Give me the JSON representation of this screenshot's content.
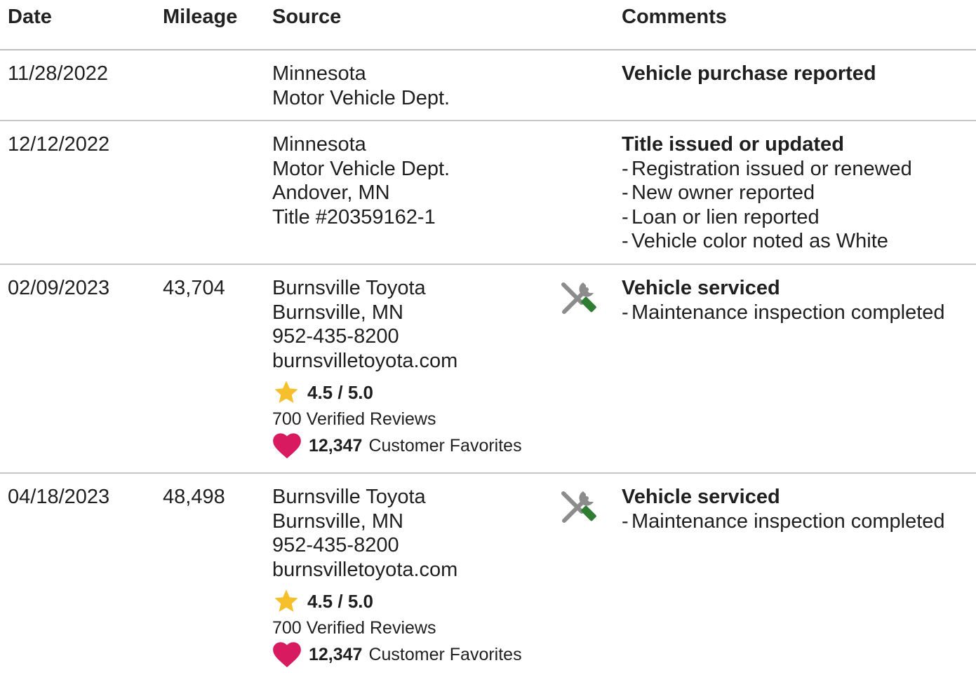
{
  "headers": {
    "date": "Date",
    "mileage": "Mileage",
    "source": "Source",
    "comments": "Comments"
  },
  "rows": [
    {
      "date": "11/28/2022",
      "mileage": "",
      "source": [
        "Minnesota",
        "Motor Vehicle Dept."
      ],
      "comment_title": "Vehicle purchase reported",
      "comment_items": []
    },
    {
      "date": "12/12/2022",
      "mileage": "",
      "source": [
        "Minnesota",
        "Motor Vehicle Dept.",
        "Andover, MN",
        "Title #20359162-1"
      ],
      "comment_title": "Title issued or updated",
      "comment_items": [
        "Registration issued or renewed",
        "New owner reported",
        "Loan or lien reported",
        "Vehicle color noted as White"
      ]
    },
    {
      "date": "02/09/2023",
      "mileage": "43,704",
      "source": [
        "Burnsville Toyota",
        "Burnsville, MN",
        "952-435-8200",
        "burnsvilletoyota.com"
      ],
      "rating": "4.5 / 5.0",
      "reviews": "700 Verified Reviews",
      "favorites_count": "12,347",
      "favorites_label": "Customer Favorites",
      "icon": "service-tools-icon",
      "comment_title": "Vehicle serviced",
      "comment_items": [
        "Maintenance inspection completed"
      ]
    },
    {
      "date": "04/18/2023",
      "mileage": "48,498",
      "source": [
        "Burnsville Toyota",
        "Burnsville, MN",
        "952-435-8200",
        "burnsvilletoyota.com"
      ],
      "rating": "4.5 / 5.0",
      "reviews": "700 Verified Reviews",
      "favorites_count": "12,347",
      "favorites_label": "Customer Favorites",
      "icon": "service-tools-icon",
      "comment_title": "Vehicle serviced",
      "comment_items": [
        "Maintenance inspection completed"
      ]
    }
  ],
  "colors": {
    "star": "#f6c02c",
    "heart": "#d81b60",
    "wrench_handle": "#2e7d32",
    "tool_gray": "#8c8c8c",
    "divider": "#c8c8c8"
  }
}
